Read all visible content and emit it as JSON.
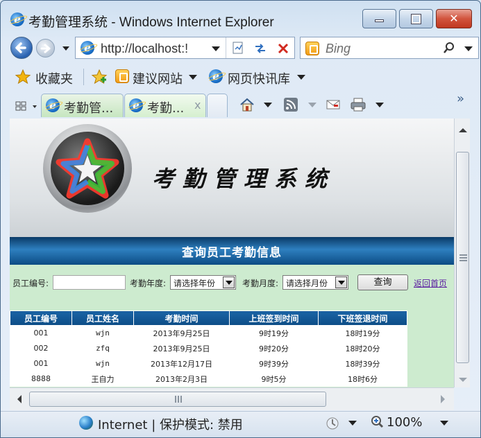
{
  "window": {
    "title": "考勤管理系统 - Windows Internet Explorer",
    "min_label": "",
    "max_label": "",
    "close_label": "✕"
  },
  "addressbar": {
    "url": "http://localhost:!",
    "search_placeholder": "Bing"
  },
  "favorites": {
    "label": "收藏夹",
    "items": [
      "建议网站",
      "网页快讯库"
    ]
  },
  "tabs": [
    {
      "label": "考勤管..."
    },
    {
      "label": "考勤..."
    }
  ],
  "page": {
    "system_title": "考勤管理系统",
    "nav_title": "查询员工考勤信息",
    "query": {
      "emp_id_label": "员工编号:",
      "emp_id_value": "",
      "year_label": "考勤年度:",
      "year_value": "请选择年份",
      "month_label": "考勤月度:",
      "month_value": "请选择月份",
      "submit_label": "查询",
      "back_label": "返回首页"
    },
    "table": {
      "headers": [
        "员工编号",
        "员工姓名",
        "考勤时间",
        "上班签到时间",
        "下班签退时间"
      ],
      "rows": [
        [
          "001",
          "wjn",
          "2013年9月25日",
          "9时19分",
          "18时19分"
        ],
        [
          "002",
          "zfq",
          "2013年9月25日",
          "9时20分",
          "18时20分"
        ],
        [
          "001",
          "wjn",
          "2013年12月17日",
          "9时39分",
          "18时39分"
        ],
        [
          "8888",
          "王自力",
          "2013年2月3日",
          "9时5分",
          "18时6分"
        ]
      ]
    }
  },
  "statusbar": {
    "zone": "Internet | 保护模式: 禁用",
    "zoom": "100%"
  },
  "colors": {
    "header_blue": "#0d4d86",
    "query_bg": "#cdebcf",
    "link_purple": "#5b1da0"
  }
}
